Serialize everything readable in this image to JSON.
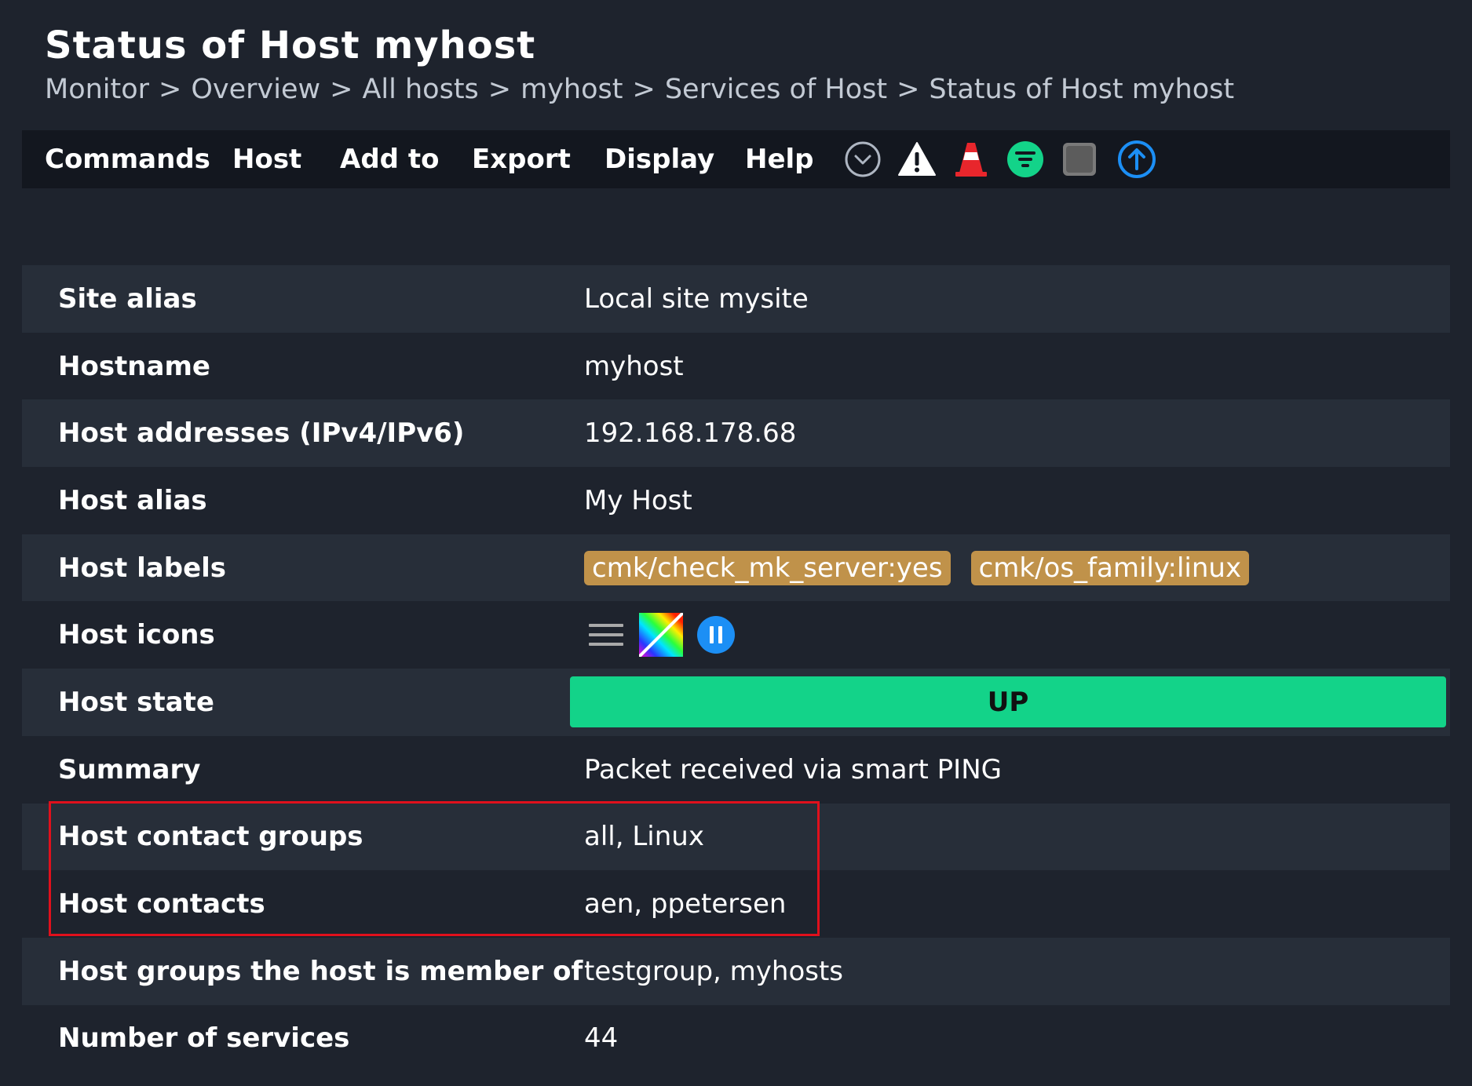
{
  "page": {
    "title": "Status of Host myhost",
    "breadcrumb": [
      "Monitor",
      "Overview",
      "All hosts",
      "myhost",
      "Services of Host",
      "Status of Host myhost"
    ],
    "breadcrumb_separator": ">"
  },
  "menubar": {
    "items": [
      "Commands",
      "Host",
      "Add to",
      "Export",
      "Display",
      "Help"
    ],
    "icons": [
      "chevron-down-circle-icon",
      "warning-icon",
      "traffic-cone-icon",
      "filter-icon",
      "checkbox-square-icon",
      "upload-arrow-icon"
    ]
  },
  "host": {
    "rows": [
      {
        "label": "Site alias",
        "value": "Local site mysite"
      },
      {
        "label": "Hostname",
        "value": "myhost"
      },
      {
        "label": "Host addresses (IPv4/IPv6)",
        "value": "192.168.178.68"
      },
      {
        "label": "Host alias",
        "value": "My Host"
      },
      {
        "label": "Host labels",
        "labels": [
          "cmk/check_mk_server:yes",
          "cmk/os_family:linux"
        ]
      },
      {
        "label": "Host icons",
        "icons": [
          "menu-icon",
          "rainbow-icon",
          "pause-icon"
        ]
      },
      {
        "label": "Host state",
        "value": "UP"
      },
      {
        "label": "Summary",
        "value": "Packet received via smart PING"
      },
      {
        "label": "Host contact groups",
        "value": "all, Linux"
      },
      {
        "label": "Host contacts",
        "value": "aen, ppetersen"
      },
      {
        "label": "Host groups the host is member of",
        "value": "testgroup, myhosts"
      },
      {
        "label": "Number of services",
        "value": "44"
      }
    ]
  },
  "colors": {
    "background": "#1e232d",
    "row_alt": "#272e39",
    "menubar": "#13171f",
    "label_chip": "#c0924a",
    "state_up": "#13d389",
    "highlight": "#e0101c"
  }
}
